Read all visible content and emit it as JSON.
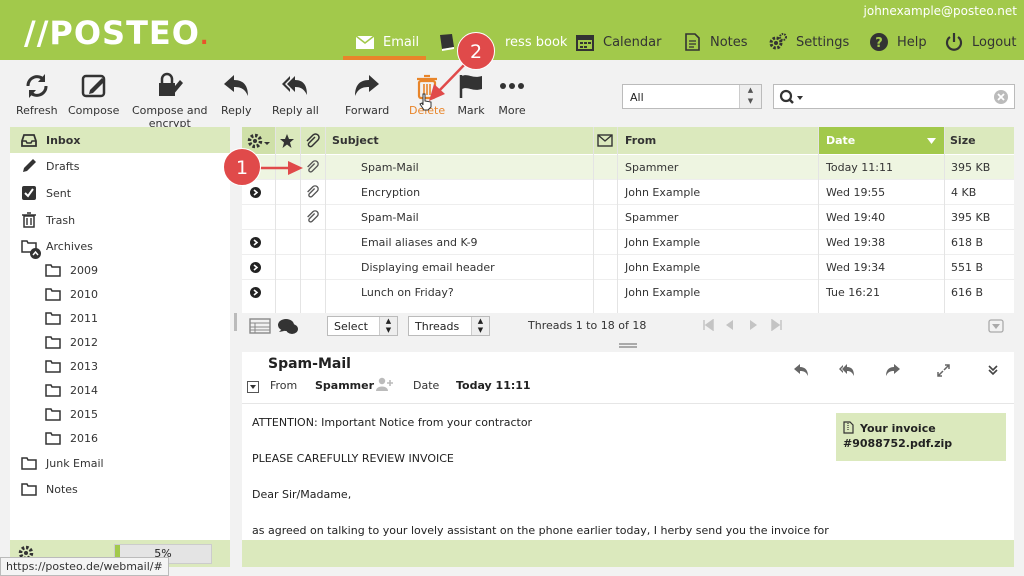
{
  "app": {
    "logo": "//POSTEO",
    "logo_dot": ".",
    "user_email": "johnexample@posteo.net"
  },
  "nav": {
    "email": "Email",
    "address_book": "ress book",
    "calendar": "Calendar",
    "notes": "Notes",
    "settings": "Settings",
    "help": "Help",
    "logout": "Logout"
  },
  "toolbar": {
    "refresh": "Refresh",
    "compose": "Compose",
    "compose_encrypt_1": "Compose and",
    "compose_encrypt_2": "encrypt",
    "reply": "Reply",
    "reply_all": "Reply all",
    "forward": "Forward",
    "delete": "Delete",
    "mark": "Mark",
    "more": "More"
  },
  "filter": {
    "value": "All"
  },
  "folders": [
    {
      "label": "Inbox"
    },
    {
      "label": "Drafts"
    },
    {
      "label": "Sent"
    },
    {
      "label": "Trash"
    },
    {
      "label": "Archives"
    },
    {
      "label": "2009"
    },
    {
      "label": "2010"
    },
    {
      "label": "2011"
    },
    {
      "label": "2012"
    },
    {
      "label": "2013"
    },
    {
      "label": "2014"
    },
    {
      "label": "2015"
    },
    {
      "label": "2016"
    },
    {
      "label": "Junk Email"
    },
    {
      "label": "Notes"
    }
  ],
  "quota": {
    "text": "5%",
    "fill": 0.05
  },
  "list": {
    "headers": {
      "subject": "Subject",
      "from": "From",
      "date": "Date",
      "size": "Size"
    },
    "rows": [
      {
        "subject": "Spam-Mail",
        "from": "Spammer",
        "date": "Today 11:11",
        "size": "395 KB"
      },
      {
        "subject": "Encryption",
        "from": "John Example",
        "date": "Wed 19:55",
        "size": "4 KB"
      },
      {
        "subject": "Spam-Mail",
        "from": "Spammer",
        "date": "Wed 19:40",
        "size": "395 KB"
      },
      {
        "subject": "Email aliases and K-9",
        "from": "John Example",
        "date": "Wed 19:38",
        "size": "618 B"
      },
      {
        "subject": "Displaying email header",
        "from": "John Example",
        "date": "Wed 19:34",
        "size": "551 B"
      },
      {
        "subject": "Lunch on Friday?",
        "from": "John Example",
        "date": "Tue 16:21",
        "size": "616 B"
      }
    ],
    "select_label": "Select",
    "threads_label": "Threads",
    "count_text": "Threads 1 to 18 of 18"
  },
  "preview": {
    "subject": "Spam-Mail",
    "from_label": "From",
    "from": "Spammer",
    "date_label": "Date",
    "date": "Today 11:11",
    "attachment_1": "Your invoice",
    "attachment_2": "#9088752.pdf.zip",
    "lines": [
      "ATTENTION: Important Notice from your contractor",
      "PLEASE CAREFULLY REVIEW INVOICE",
      "Dear Sir/Madame,",
      "as agreed on talking to your lovely assistant on the phone earlier today, I herby send you the invoice for"
    ]
  },
  "statusbar": {
    "url": "https://posteo.de/webmail/#"
  },
  "callouts": {
    "one": "1",
    "two": "2"
  },
  "colors": {
    "brand": "#a2c94b",
    "accent": "#e8852a",
    "highlight": "#dbe9bd",
    "callout": "#e04a4a",
    "delete": "#e8852a"
  }
}
